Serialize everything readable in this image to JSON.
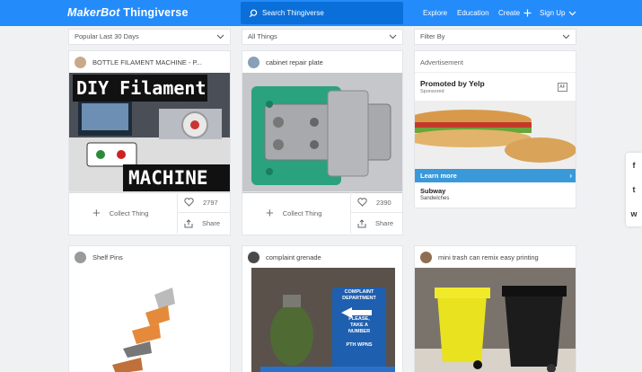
{
  "brand": {
    "logo_a": "MakerBot",
    "logo_b": "Thingiverse"
  },
  "search": {
    "placeholder": "Search Thingiverse"
  },
  "nav": {
    "explore": "Explore",
    "education": "Education",
    "create": "Create",
    "signup": "Sign Up"
  },
  "filters": {
    "sort": "Popular Last 30 Days",
    "category": "All Things",
    "filter": "Filter By"
  },
  "cards": [
    {
      "title": "BOTTLE FILAMENT MACHINE - P...",
      "image_text_top": "DIY Filament",
      "image_text_bottom": "MACHINE",
      "likes": "2797",
      "collect": "Collect Thing",
      "share": "Share"
    },
    {
      "title": "cabinet repair plate",
      "likes": "2390",
      "collect": "Collect Thing",
      "share": "Share"
    },
    {
      "title": "Shelf Pins"
    },
    {
      "title": "complaint grenade",
      "sign_lines": [
        "COMPLAINT",
        "DEPARTMENT",
        "PLEASE,",
        "TAKE A",
        "NUMBER",
        "PTH WPNS"
      ]
    },
    {
      "title": "mini trash can remix easy printing"
    }
  ],
  "ad": {
    "label": "Advertisement",
    "title": "Promoted by Yelp",
    "sponsored": "Sponsored",
    "badge": "AF",
    "cta": "Learn more",
    "name": "Subway",
    "category": "Sandwiches"
  },
  "social": [
    "f",
    "t",
    "w"
  ],
  "colors": {
    "topbar": "#248bfb",
    "search_bg": "#0b6fd9",
    "learn_more": "#3a9ad9"
  }
}
